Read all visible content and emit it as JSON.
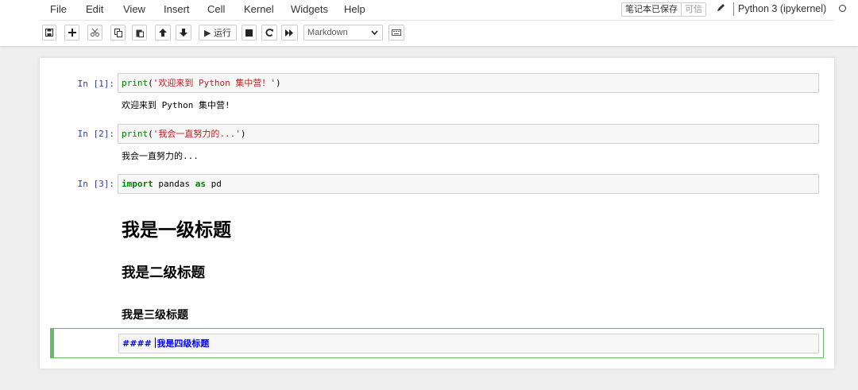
{
  "menu": [
    "File",
    "Edit",
    "View",
    "Insert",
    "Cell",
    "Kernel",
    "Widgets",
    "Help"
  ],
  "status": {
    "saved": "笔记本已保存",
    "trusted": "可信",
    "kernel": "Python 3 (ipykernel)"
  },
  "toolbar": {
    "run_label": "▶ 运行",
    "cell_type": "Markdown",
    "icons": [
      "save-icon",
      "plus-icon",
      "cut-icon",
      "copy-icon",
      "paste-icon",
      "arrow-up-icon",
      "arrow-down-icon",
      "run-icon",
      "stop-icon",
      "restart-icon",
      "fast-forward-icon",
      "keyboard-icon"
    ]
  },
  "cells": [
    {
      "prompt": "In  [1]:",
      "code": {
        "fn": "print",
        "open": "(",
        "str": "'欢迎来到 Python 集中营！'",
        "close": ")"
      },
      "output": "欢迎来到 Python 集中营!"
    },
    {
      "prompt": "In  [2]:",
      "code": {
        "fn": "print",
        "open": "(",
        "str": "'我会一直努力的...'",
        "close": ")"
      },
      "output": "我会一直努力的..."
    },
    {
      "prompt": "In  [3]:",
      "code": {
        "kw1": "import",
        "mid": " pandas ",
        "kw2": "as",
        "end": " pd"
      }
    }
  ],
  "markdown": {
    "h1": "我是一级标题",
    "h2": "我是二级标题",
    "h3": "我是三级标题",
    "editing_hash": "####",
    "editing_text": "我是四级标题"
  },
  "colors": {
    "selected_border": "#66bb6a",
    "prompt": "#303f9f",
    "code_keyword": "#008000",
    "code_string": "#ba2121",
    "md_header": "#0000ff"
  }
}
